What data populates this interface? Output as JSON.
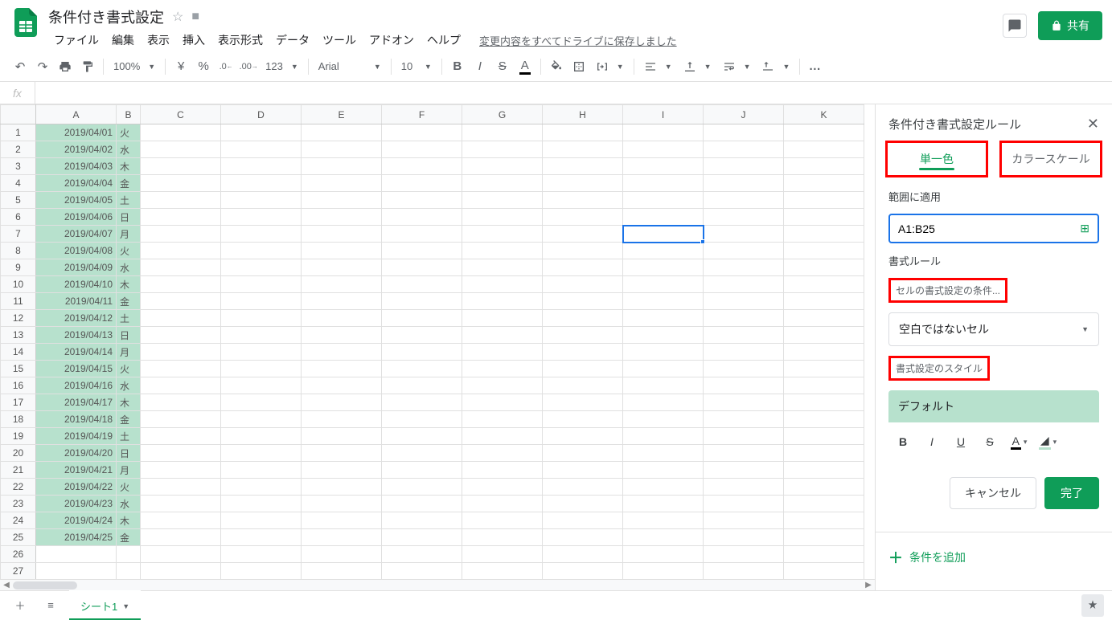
{
  "doc_title": "条件付き書式設定",
  "menus": [
    "ファイル",
    "編集",
    "表示",
    "挿入",
    "表示形式",
    "データ",
    "ツール",
    "アドオン",
    "ヘルプ"
  ],
  "save_status": "変更内容をすべてドライブに保存しました",
  "share_label": "共有",
  "toolbar": {
    "zoom": "100%",
    "currency": "¥",
    "percent": "%",
    "dec_dec": ".0",
    "inc_dec": ".00",
    "more_formats": "123",
    "font": "Arial",
    "font_size": "10",
    "more": "…"
  },
  "columns": [
    "A",
    "B",
    "C",
    "D",
    "E",
    "F",
    "G",
    "H",
    "I",
    "J",
    "K"
  ],
  "rows": [
    {
      "n": 1,
      "a": "2019/04/01",
      "b": "火"
    },
    {
      "n": 2,
      "a": "2019/04/02",
      "b": "水"
    },
    {
      "n": 3,
      "a": "2019/04/03",
      "b": "木"
    },
    {
      "n": 4,
      "a": "2019/04/04",
      "b": "金"
    },
    {
      "n": 5,
      "a": "2019/04/05",
      "b": "土"
    },
    {
      "n": 6,
      "a": "2019/04/06",
      "b": "日"
    },
    {
      "n": 7,
      "a": "2019/04/07",
      "b": "月"
    },
    {
      "n": 8,
      "a": "2019/04/08",
      "b": "火"
    },
    {
      "n": 9,
      "a": "2019/04/09",
      "b": "水"
    },
    {
      "n": 10,
      "a": "2019/04/10",
      "b": "木"
    },
    {
      "n": 11,
      "a": "2019/04/11",
      "b": "金"
    },
    {
      "n": 12,
      "a": "2019/04/12",
      "b": "土"
    },
    {
      "n": 13,
      "a": "2019/04/13",
      "b": "日"
    },
    {
      "n": 14,
      "a": "2019/04/14",
      "b": "月"
    },
    {
      "n": 15,
      "a": "2019/04/15",
      "b": "火"
    },
    {
      "n": 16,
      "a": "2019/04/16",
      "b": "水"
    },
    {
      "n": 17,
      "a": "2019/04/17",
      "b": "木"
    },
    {
      "n": 18,
      "a": "2019/04/18",
      "b": "金"
    },
    {
      "n": 19,
      "a": "2019/04/19",
      "b": "土"
    },
    {
      "n": 20,
      "a": "2019/04/20",
      "b": "日"
    },
    {
      "n": 21,
      "a": "2019/04/21",
      "b": "月"
    },
    {
      "n": 22,
      "a": "2019/04/22",
      "b": "火"
    },
    {
      "n": 23,
      "a": "2019/04/23",
      "b": "水"
    },
    {
      "n": 24,
      "a": "2019/04/24",
      "b": "木"
    },
    {
      "n": 25,
      "a": "2019/04/25",
      "b": "金"
    },
    {
      "n": 26,
      "a": "",
      "b": ""
    },
    {
      "n": 27,
      "a": "",
      "b": ""
    }
  ],
  "selected_cell": "I7",
  "panel": {
    "title": "条件付き書式設定ルール",
    "tab_single": "単一色",
    "tab_scale": "カラースケール",
    "apply_to_label": "範囲に適用",
    "range_value": "A1:B25",
    "format_rules_label": "書式ルール",
    "condition_label": "セルの書式設定の条件...",
    "condition_value": "空白ではないセル",
    "style_label": "書式設定のスタイル",
    "style_preview": "デフォルト",
    "cancel": "キャンセル",
    "done": "完了",
    "add_rule": "条件を追加"
  },
  "sheet_tab": "シート1"
}
